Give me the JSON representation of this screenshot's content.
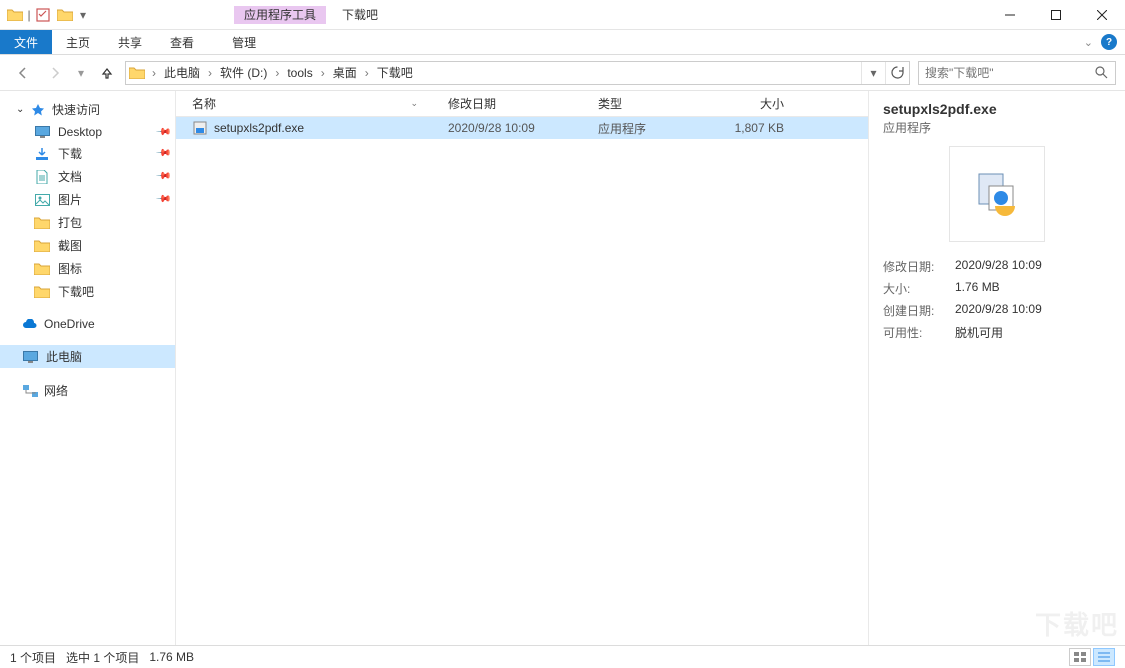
{
  "titlebar": {
    "contextual_tab": "应用程序工具",
    "window_title": "下载吧"
  },
  "ribbon": {
    "file": "文件",
    "home": "主页",
    "share": "共享",
    "view": "查看",
    "manage": "管理"
  },
  "address": {
    "segments": [
      "此电脑",
      "软件 (D:)",
      "tools",
      "桌面",
      "下载吧"
    ]
  },
  "search": {
    "placeholder": "搜索\"下载吧\""
  },
  "sidebar": {
    "quick_access": "快速访问",
    "items": [
      {
        "label": "Desktop",
        "pinned": true,
        "icon": "desktop"
      },
      {
        "label": "下载",
        "pinned": true,
        "icon": "downloads"
      },
      {
        "label": "文档",
        "pinned": true,
        "icon": "documents"
      },
      {
        "label": "图片",
        "pinned": true,
        "icon": "pictures"
      },
      {
        "label": "打包",
        "pinned": false,
        "icon": "folder"
      },
      {
        "label": "截图",
        "pinned": false,
        "icon": "folder"
      },
      {
        "label": "图标",
        "pinned": false,
        "icon": "folder"
      },
      {
        "label": "下载吧",
        "pinned": false,
        "icon": "folder"
      }
    ],
    "onedrive": "OneDrive",
    "this_pc": "此电脑",
    "network": "网络"
  },
  "columns": {
    "name": "名称",
    "date": "修改日期",
    "type": "类型",
    "size": "大小"
  },
  "files": [
    {
      "name": "setupxls2pdf.exe",
      "date": "2020/9/28 10:09",
      "type": "应用程序",
      "size": "1,807 KB",
      "selected": true
    }
  ],
  "details": {
    "title": "setupxls2pdf.exe",
    "subtype": "应用程序",
    "modified_label": "修改日期:",
    "modified": "2020/9/28 10:09",
    "size_label": "大小:",
    "size": "1.76 MB",
    "created_label": "创建日期:",
    "created": "2020/9/28 10:09",
    "avail_label": "可用性:",
    "avail": "脱机可用"
  },
  "status": {
    "items": "1 个项目",
    "selected": "选中 1 个项目",
    "sel_size": "1.76 MB"
  },
  "watermark": "下载吧"
}
